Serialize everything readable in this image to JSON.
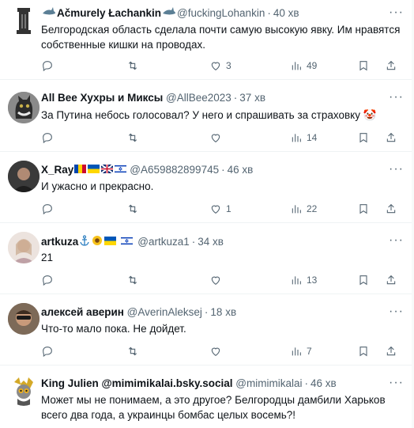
{
  "tweets": [
    {
      "name": "Ačmurely Łachankin",
      "handle": "@fuckingLohankin",
      "time": "40 хв",
      "text": "Белгородская область сделала почти самую высокую явку. Им нравятся собственные кишки на проводах.",
      "replies": "",
      "retweets": "",
      "likes": "3",
      "views": "49"
    },
    {
      "name": "All Bee Хухры и Миксы",
      "handle": "@AllBee2023",
      "time": "37 хв",
      "text": "За Путина небось голосовал? У него и спрашивать за страховку 🤡",
      "replies": "",
      "retweets": "",
      "likes": "",
      "views": "14"
    },
    {
      "name": "X_Ray",
      "handle": "@A659882899745",
      "time": "46 хв",
      "text": "И ужасно и прекрасно.",
      "replies": "",
      "retweets": "",
      "likes": "1",
      "views": "22"
    },
    {
      "name": "artkuza",
      "handle": "@artkuza1",
      "time": "34 хв",
      "text": "21",
      "replies": "",
      "retweets": "",
      "likes": "",
      "views": "13"
    },
    {
      "name": "алексей аверин",
      "handle": "@AverinAleksej",
      "time": "18 хв",
      "text": "Что-то мало пока. Не дойдет.",
      "replies": "",
      "retweets": "",
      "likes": "",
      "views": "7"
    },
    {
      "name": "King Julien @mimimikalai.bsky.social",
      "handle": "@mimimikalai",
      "time": "46 хв",
      "text": "Может мы не понимаем, а это другое? Белгородцы дамбили Харьков всего два года, а украинцы бомбас целых восемь?!",
      "replies": "",
      "retweets": "",
      "likes": "",
      "views": ""
    }
  ],
  "colors": {
    "secondary": "#536471",
    "divider": "#eff3f4",
    "text": "#0f1419"
  }
}
